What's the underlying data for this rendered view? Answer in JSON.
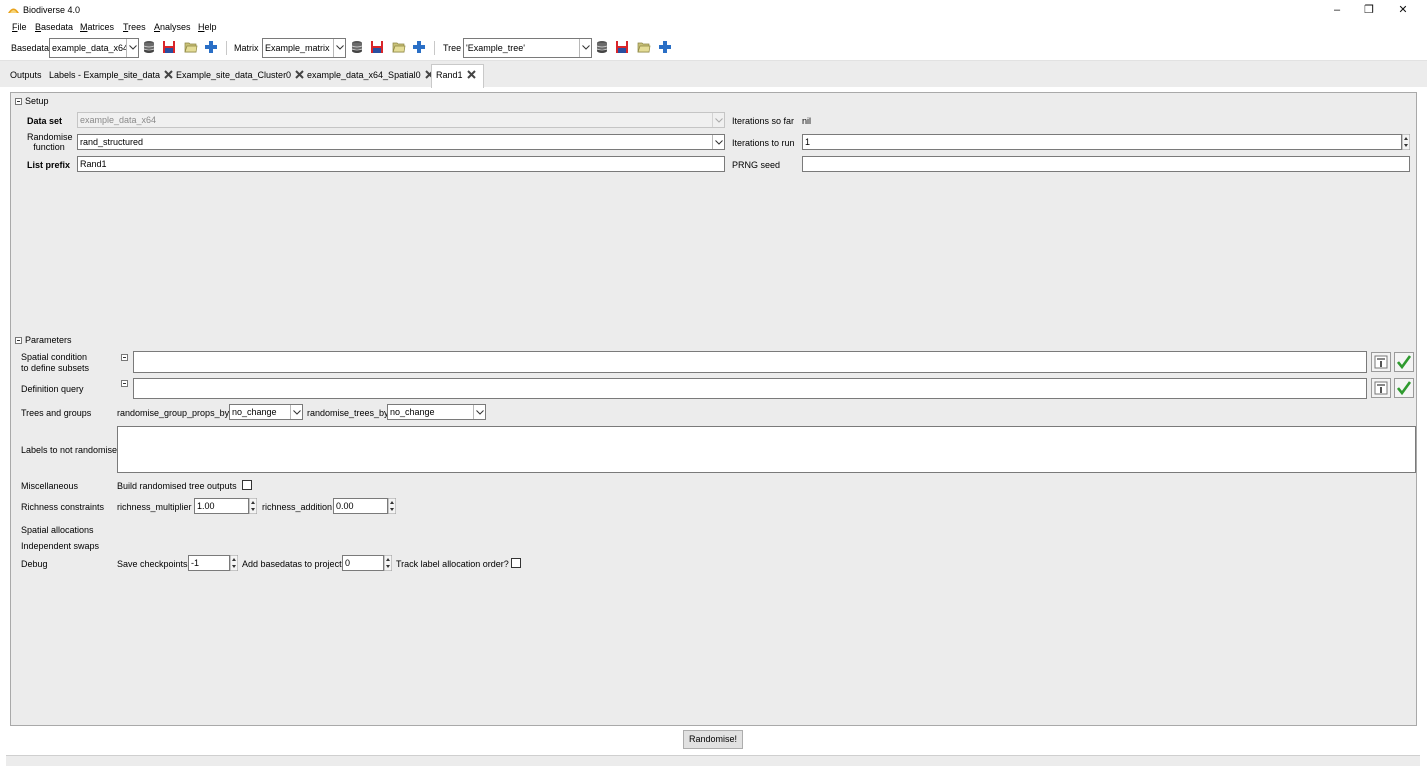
{
  "window": {
    "title": "Biodiverse 4.0",
    "controls": {
      "minimize": "–",
      "maximize": "❐",
      "close": "✕"
    }
  },
  "menu": {
    "items": [
      {
        "accel": "F",
        "rest": "ile"
      },
      {
        "accel": "B",
        "rest": "asedata"
      },
      {
        "accel": "M",
        "rest": "atrices"
      },
      {
        "accel": "T",
        "rest": "rees"
      },
      {
        "accel": "A",
        "rest": "nalyses"
      },
      {
        "accel": "H",
        "rest": "elp"
      }
    ]
  },
  "toolbar": {
    "basedata_label": "Basedata",
    "basedata_value": "example_data_x64",
    "matrix_label": "Matrix",
    "matrix_value": "Example_matrix",
    "tree_label": "Tree",
    "tree_value": "'Example_tree'",
    "icons": [
      "database-icon",
      "save-icon",
      "open-folder-icon",
      "add-icon"
    ]
  },
  "tabs": [
    {
      "label": "Outputs",
      "closable": false,
      "active": false
    },
    {
      "label": "Labels - Example_site_data",
      "closable": true,
      "active": false
    },
    {
      "label": "Example_site_data_Cluster0",
      "closable": true,
      "active": false
    },
    {
      "label": "example_data_x64_Spatial0",
      "closable": true,
      "active": false
    },
    {
      "label": "Rand1",
      "closable": true,
      "active": true
    }
  ],
  "setup": {
    "header": "Setup",
    "data_set_label": "Data set",
    "data_set_value": "example_data_x64",
    "randomise_function_label_1": "Randomise",
    "randomise_function_label_2": "function",
    "randomise_function_value": "rand_structured",
    "list_prefix_label": "List prefix",
    "list_prefix_value": "Rand1",
    "iterations_so_far_label": "Iterations so far",
    "iterations_so_far_value": "nil",
    "iterations_to_run_label": "Iterations to run",
    "iterations_to_run_value": "1",
    "prng_seed_label": "PRNG seed",
    "prng_seed_value": ""
  },
  "parameters": {
    "header": "Parameters",
    "spatial_condition_label_1": "Spatial condition",
    "spatial_condition_label_2": "to define subsets",
    "spatial_condition_value": "",
    "definition_query_label": "Definition query",
    "definition_query_value": "",
    "trees_and_groups_label": "Trees and groups",
    "randomise_group_props_by_label": "randomise_group_props_by",
    "randomise_group_props_by_value": "no_change",
    "randomise_trees_by_label": "randomise_trees_by",
    "randomise_trees_by_value": "no_change",
    "labels_not_randomise_label": "Labels to not randomise",
    "labels_not_randomise_value": "",
    "miscellaneous_label": "Miscellaneous",
    "build_tree_outputs_label": "Build randomised tree outputs",
    "build_tree_outputs_checked": false,
    "richness_constraints_label": "Richness constraints",
    "richness_multiplier_label": "richness_multiplier",
    "richness_multiplier_value": "1.00",
    "richness_addition_label": "richness_addition",
    "richness_addition_value": "0.00",
    "spatial_allocations_label": "Spatial allocations",
    "independent_swaps_label": "Independent swaps",
    "debug_label": "Debug",
    "save_checkpoints_label": "Save checkpoints",
    "save_checkpoints_value": "-1",
    "add_basedatas_label": "Add basedatas to project",
    "add_basedatas_value": "0",
    "track_label_order_label": "Track label allocation order?",
    "track_label_order_checked": false
  },
  "actions": {
    "randomise_button": "Randomise!"
  },
  "colors": {
    "panel_bg": "#ececec",
    "save_icon_red": "#d9252a",
    "add_icon_blue": "#2a6fc6",
    "check_green": "#2f9a2f"
  }
}
